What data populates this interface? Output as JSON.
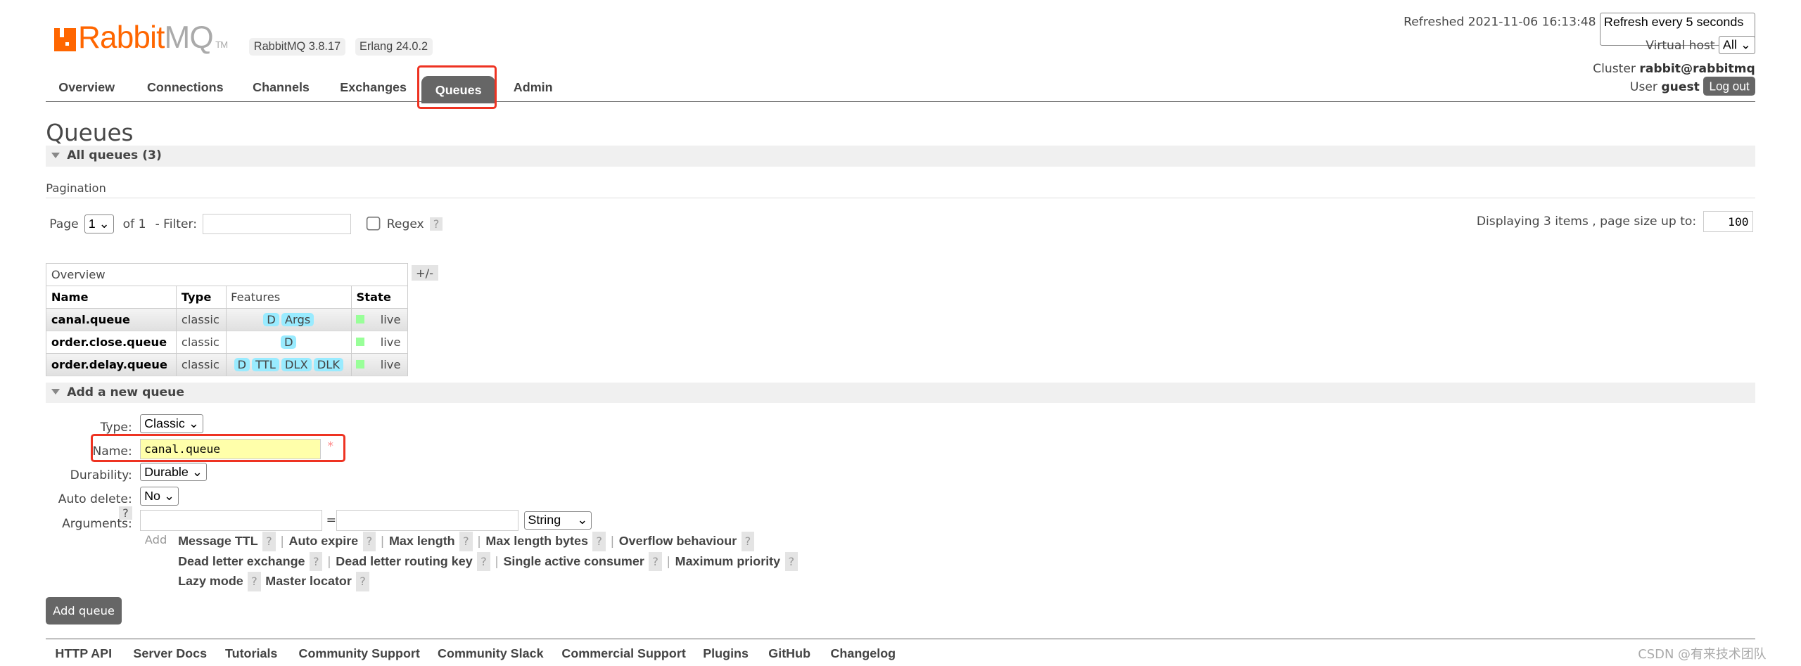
{
  "header": {
    "logo_text_orange": "Rabbit",
    "logo_text_gray": "MQ",
    "logo_tm": "TM",
    "version": "RabbitMQ 3.8.17",
    "erlang": "Erlang 24.0.2",
    "refreshed": "Refreshed 2021-11-06 16:13:48",
    "refresh_select": "Refresh every 5 seconds",
    "vhost_label": "Virtual host",
    "vhost_value": "All",
    "cluster_label": "Cluster",
    "cluster_value": "rabbit@rabbitmq",
    "user_label": "User",
    "user_value": "guest",
    "logout": "Log out"
  },
  "nav": [
    {
      "label": "Overview"
    },
    {
      "label": "Connections"
    },
    {
      "label": "Channels"
    },
    {
      "label": "Exchanges"
    },
    {
      "label": "Queues",
      "active": true
    },
    {
      "label": "Admin"
    }
  ],
  "page": {
    "title": "Queues",
    "all_queues": "All queues (3)",
    "pagination": "Pagination",
    "page_label": "Page",
    "page_value": "1",
    "of": "of 1",
    "filter_label": "- Filter:",
    "regex": "Regex",
    "help": "?",
    "displaying": "Displaying 3 items , page size up to:",
    "page_size": "100"
  },
  "table": {
    "group": "Overview",
    "toggle": "+/-",
    "headers": [
      "Name",
      "Type",
      "Features",
      "State"
    ],
    "rows": [
      {
        "name": "canal.queue",
        "type": "classic",
        "features": [
          "D",
          "Args"
        ],
        "state": "live"
      },
      {
        "name": "order.close.queue",
        "type": "classic",
        "features": [
          "D"
        ],
        "state": "live"
      },
      {
        "name": "order.delay.queue",
        "type": "classic",
        "features": [
          "D",
          "TTL",
          "DLX",
          "DLK"
        ],
        "state": "live"
      }
    ]
  },
  "form": {
    "section": "Add a new queue",
    "type_label": "Type:",
    "type_value": "Classic",
    "name_label": "Name:",
    "name_value": "canal.queue",
    "required": "*",
    "durability_label": "Durability:",
    "durability_value": "Durable",
    "autodelete_label": "Auto delete:",
    "autodelete_value": "No",
    "arguments_label": "Arguments:",
    "eq": "=",
    "arg_type": "String",
    "add": "Add",
    "arg_lines": [
      [
        "Message TTL",
        "Auto expire",
        "Max length",
        "Max length bytes",
        "Overflow behaviour"
      ],
      [
        "Dead letter exchange",
        "Dead letter routing key",
        "Single active consumer",
        "Maximum priority"
      ],
      [
        "Lazy mode",
        "Master locator"
      ]
    ],
    "submit": "Add queue"
  },
  "footer": [
    "HTTP API",
    "Server Docs",
    "Tutorials",
    "Community Support",
    "Community Slack",
    "Commercial Support",
    "Plugins",
    "GitHub",
    "Changelog"
  ],
  "watermark": "CSDN @有来技术团队",
  "colors": {
    "brand": "#ff6600",
    "tab_active": "#666666",
    "feature_badge": "#99ebff",
    "live": "#99ff99",
    "highlight": "#e33322"
  }
}
